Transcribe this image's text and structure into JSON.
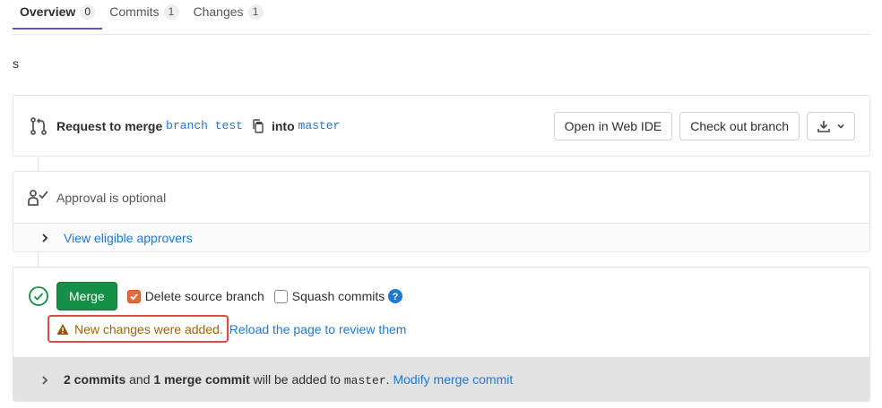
{
  "tabs": [
    {
      "label": "Overview",
      "count": "0"
    },
    {
      "label": "Commits",
      "count": "1"
    },
    {
      "label": "Changes",
      "count": "1"
    }
  ],
  "description": "s",
  "request": {
    "prefix": "Request to merge",
    "source_branch": "branch test",
    "into": "into",
    "target_branch": "master",
    "open_ide_label": "Open in Web IDE",
    "checkout_label": "Check out branch"
  },
  "approval": {
    "label": "Approval is optional",
    "view_approvers": "View eligible approvers"
  },
  "merge": {
    "button_label": "Merge",
    "delete_source_label": "Delete source branch",
    "delete_source_checked": true,
    "squash_label": "Squash commits",
    "squash_checked": false,
    "warning_text": "New changes were added.",
    "reload_text": "Reload the page to review them",
    "commits_count": "2 commits",
    "and_text": "and",
    "merge_commit_text": "1 merge commit",
    "will_be_added": "will be added to",
    "target_branch": "master",
    "period": ".",
    "modify_link": "Modify merge commit"
  },
  "colors": {
    "accent": "#6b4fbb",
    "link": "#1f78d1",
    "merge_green": "#168f48",
    "warning": "#a16200",
    "highlight_border": "#e24a4a"
  }
}
